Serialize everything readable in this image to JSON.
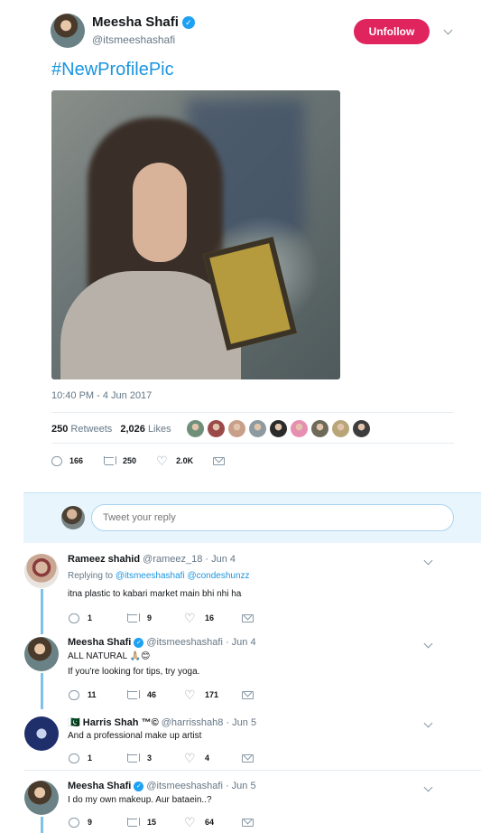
{
  "tweet": {
    "author_name": "Meesha Shafi",
    "verified_glyph": "✓",
    "author_handle": "@itsmeeshashafi",
    "follow_button": "Unfollow",
    "text": "#NewProfilePic",
    "timestamp": "10:40 PM - 4 Jun 2017",
    "retweets_count": "250",
    "retweets_label": "Retweets",
    "likes_count": "2,026",
    "likes_label": "Likes",
    "likers_colors": [
      "#6f8f7a",
      "#9b4a4a",
      "#c8a08a",
      "#8d9aa0",
      "#2b2b2b",
      "#e78fb0",
      "#6e6a5a",
      "#b9a678",
      "#3d3d3d"
    ],
    "actions": {
      "reply": "166",
      "retweet": "250",
      "like": "2.0K"
    }
  },
  "composer": {
    "placeholder": "Tweet your reply"
  },
  "replies": [
    {
      "name": "Rameez shahid",
      "handle": "@rameez_18 · Jun 4",
      "replying_prefix": "Replying to",
      "replying_1": "@itsmeeshashafi",
      "replying_2": "@condeshunzz",
      "text": "itna plastic to kabari market main bhi nhi ha",
      "reply": "1",
      "retweet": "9",
      "like": "16"
    },
    {
      "name": "Meesha Shafi",
      "handle": "@itsmeeshashafi · Jun 4",
      "text": "ALL NATURAL 🙏🏼😊",
      "text2": "If you're looking for tips, try yoga.",
      "reply": "11",
      "retweet": "46",
      "like": "171"
    },
    {
      "flag": "🇵🇰",
      "name": "Harris Shah ™©",
      "handle": "@harrisshah8 · Jun 5",
      "text": "And a professional make up artist",
      "reply": "1",
      "retweet": "3",
      "like": "4"
    },
    {
      "name": "Meesha Shafi",
      "handle": "@itsmeeshashafi · Jun 5",
      "text": "I do my own makeup. Aur bataein..?",
      "reply": "9",
      "retweet": "15",
      "like": "64"
    }
  ]
}
